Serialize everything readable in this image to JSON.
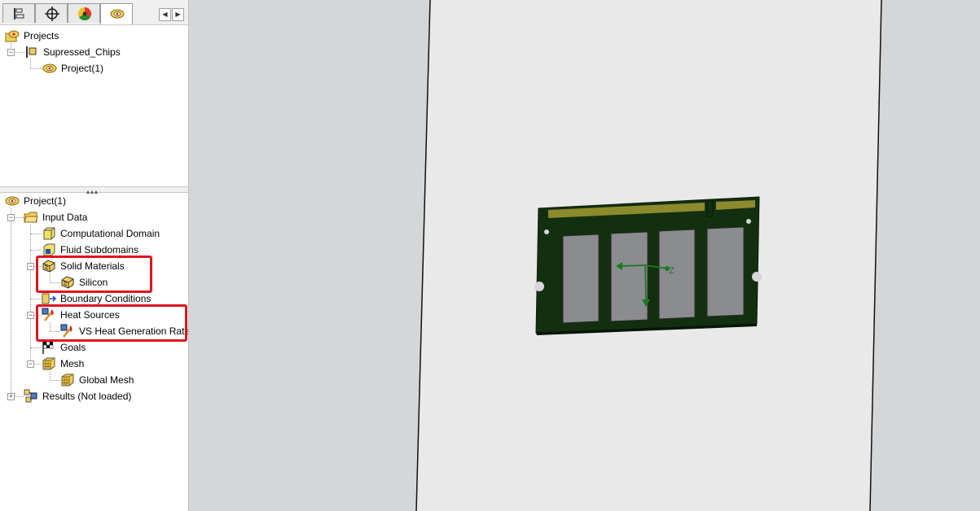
{
  "top_tree": {
    "root": {
      "label": "Projects",
      "icon": "flow-project-icon"
    },
    "config": {
      "label": "Supressed_Chips",
      "icon": "configuration-icon"
    },
    "project": {
      "label": "Project(1)",
      "icon": "flow-project-icon"
    }
  },
  "tabs": [
    {
      "name": "feature-manager-tab",
      "icon": "feature-tree-icon"
    },
    {
      "name": "configuration-tab",
      "icon": "crosshair-icon"
    },
    {
      "name": "appearance-tab",
      "icon": "color-wheel-icon"
    },
    {
      "name": "flow-simulation-tab",
      "icon": "flow-project-icon",
      "active": true
    }
  ],
  "analysis_tree": {
    "project": "Project(1)",
    "input_data": "Input Data",
    "computational_domain": "Computational Domain",
    "fluid_subdomains": "Fluid Subdomains",
    "solid_materials": "Solid Materials",
    "silicon": "Silicon",
    "boundary_conditions": "Boundary Conditions",
    "heat_sources": "Heat Sources",
    "vs_heat_generation_rate": "VS Heat Generation Rate",
    "goals": "Goals",
    "mesh": "Mesh",
    "global_mesh": "Global Mesh",
    "results": "Results (Not loaded)"
  },
  "viewport": {
    "background_color": "#d5d6d7",
    "pcb_color": "#12300f",
    "chip_color": "#8b8c8f",
    "contact_color": "#8c8a2c",
    "triad_color": "#1a7a20",
    "triad_axis_label": "Z"
  },
  "highlight_color": "#e0141e"
}
